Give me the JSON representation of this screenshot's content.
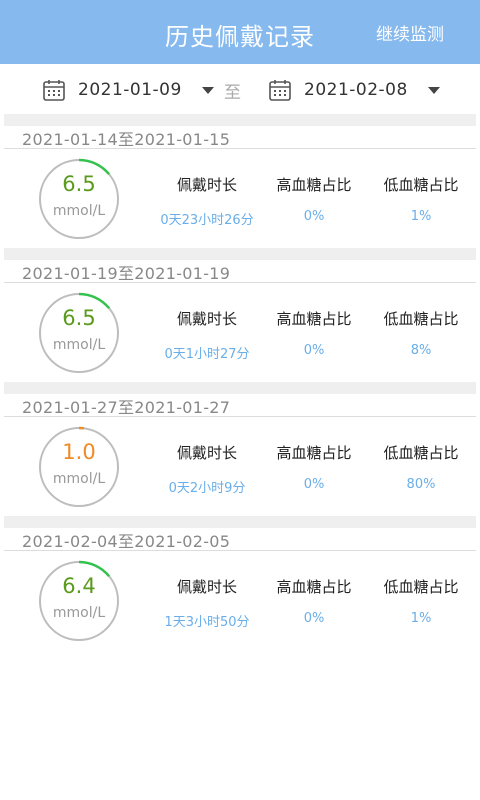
{
  "header": {
    "title": "历史佩戴记录",
    "action_label": "继续监测"
  },
  "datebar": {
    "start_date": "2021-01-09",
    "separator": "至",
    "end_date": "2021-02-08",
    "calendar_icon": "calendar-icon",
    "caret_icon": "caret-down-icon"
  },
  "columns": {
    "duration_label": "佩戴时长",
    "high_label": "高血糖占比",
    "low_label": "低血糖占比"
  },
  "colors": {
    "header_bg": "#86b9ee",
    "normal": "#5a9a1c",
    "low": "#f08a24",
    "ring_track": "#bdbdbd",
    "ring_normal": "#33c24d",
    "value_blue": "#6aaee9"
  },
  "records": [
    {
      "range": "2021-01-14至2021-01-15",
      "glucose": "6.5",
      "unit": "mmol/L",
      "status": "normal",
      "arc_fraction": 0.14,
      "duration": "0天23小时26分",
      "high_pct": "0%",
      "low_pct": "1%"
    },
    {
      "range": "2021-01-19至2021-01-19",
      "glucose": "6.5",
      "unit": "mmol/L",
      "status": "normal",
      "arc_fraction": 0.14,
      "duration": "0天1小时27分",
      "high_pct": "0%",
      "low_pct": "8%"
    },
    {
      "range": "2021-01-27至2021-01-27",
      "glucose": "1.0",
      "unit": "mmol/L",
      "status": "low",
      "arc_fraction": 0.02,
      "duration": "0天2小时9分",
      "high_pct": "0%",
      "low_pct": "80%"
    },
    {
      "range": "2021-02-04至2021-02-05",
      "glucose": "6.4",
      "unit": "mmol/L",
      "status": "normal",
      "arc_fraction": 0.14,
      "duration": "1天3小时50分",
      "high_pct": "0%",
      "low_pct": "1%"
    }
  ]
}
